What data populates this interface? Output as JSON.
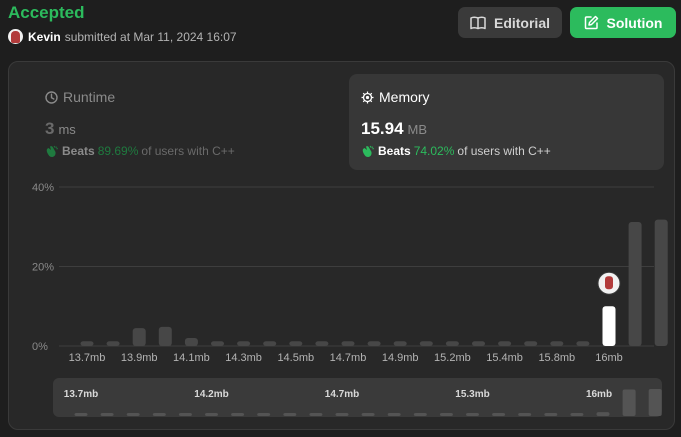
{
  "header": {
    "status": "Accepted",
    "username": "Kevin",
    "submitted_text": "submitted at Mar 11, 2024 16:07",
    "editorial_label": "Editorial",
    "solution_label": "Solution"
  },
  "runtime": {
    "title": "Runtime",
    "value": "3",
    "unit": "ms",
    "beats_label": "Beats",
    "beats_pct": "89.69%",
    "beats_suffix": "of users with C++"
  },
  "memory": {
    "title": "Memory",
    "value": "15.94",
    "unit": "MB",
    "beats_label": "Beats",
    "beats_pct": "74.02%",
    "beats_suffix": "of users with C++"
  },
  "colors": {
    "accent": "#2cbb5d",
    "bar": "#474747",
    "bar_selected": "#ffffff"
  },
  "chart_data": {
    "type": "bar",
    "y_ticks": [
      "40%",
      "20%",
      "0%"
    ],
    "ylim": [
      0,
      40
    ],
    "grid": true,
    "x_tick_labels": [
      "13.7mb",
      "13.9mb",
      "14.1mb",
      "14.3mb",
      "14.5mb",
      "14.7mb",
      "14.9mb",
      "15.2mb",
      "15.4mb",
      "15.8mb",
      "16mb"
    ],
    "values": [
      1.2,
      1.2,
      4.5,
      4.8,
      2.0,
      1.2,
      1.2,
      1.2,
      1.2,
      1.2,
      1.2,
      1.2,
      1.2,
      1.2,
      1.2,
      1.2,
      1.2,
      1.2,
      1.2,
      1.2,
      10.0,
      31.2,
      31.8
    ],
    "selected_index": 20,
    "overview": {
      "tick_labels": [
        "13.7mb",
        "14.2mb",
        "14.7mb",
        "15.3mb",
        "16mb"
      ],
      "values": [
        1.2,
        1.2,
        1.2,
        1.2,
        1.2,
        1.2,
        1.2,
        1.2,
        1.2,
        1.2,
        1.2,
        1.2,
        1.2,
        1.2,
        1.2,
        1.2,
        1.2,
        1.2,
        1.2,
        1.2,
        4.5,
        31.2,
        31.8
      ]
    }
  }
}
